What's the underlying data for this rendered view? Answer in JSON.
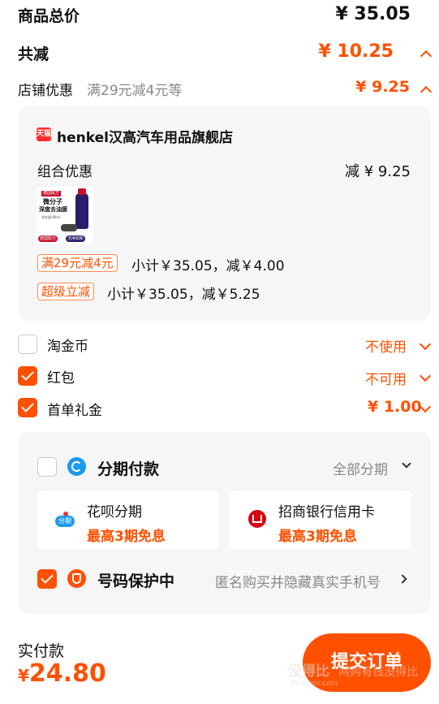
{
  "summary": {
    "total_label": "商品总价",
    "total_value": "¥ 35.05",
    "discount_label": "共减",
    "discount_value": "¥ 10.25",
    "store_discount_label": "店铺优惠",
    "store_discount_desc": "满29元减4元等",
    "store_discount_value": "¥ 9.25"
  },
  "store": {
    "badge": "天猫",
    "name": "henkel汉高汽车用品旗舰店",
    "combo_label": "组合优惠",
    "combo_value": "减 ¥ 9.25",
    "product_image_text": {
      "top": "德国配方",
      "title1": "微分子",
      "title2": "深度去油膜",
      "volume": "净含量:80ml",
      "bottom_left": "德国配方",
      "bottom_right": "洁净如新"
    },
    "promos": [
      {
        "tag": "满29元减4元",
        "text": "小计￥35.05，减￥4.00"
      },
      {
        "tag": "超级立减",
        "text": "小计￥35.05，减￥5.25"
      }
    ]
  },
  "options": [
    {
      "label": "淘金币",
      "value": "不使用",
      "checked": false
    },
    {
      "label": "红包",
      "value": "不可用",
      "checked": true
    },
    {
      "label": "首单礼金",
      "value": "¥ 1.00",
      "checked": true
    }
  ],
  "installment": {
    "title": "分期付款",
    "select_label": "全部分期",
    "plans": [
      {
        "name": "花呗分期",
        "promo": "最高3期免息",
        "icon": "huabei-icon",
        "icon_text": "分期"
      },
      {
        "name": "招商银行信用卡",
        "promo": "最高3期免息",
        "icon": "cmb-bank-icon"
      }
    ]
  },
  "privacy": {
    "title": "号码保护中",
    "desc": "匿名购买并隐藏真实手机号"
  },
  "footer": {
    "pay_label": "实付款",
    "pay_currency": "¥",
    "pay_value": "24.80",
    "submit_label": "提交订单"
  },
  "watermark": {
    "text1": "没得比",
    "text2": "网购有钱没得比",
    "url": "Meidebi.com"
  },
  "colors": {
    "accent": "#ff5000",
    "card_bg": "#f6f6f6",
    "blue_icon": "#1a9bf0"
  }
}
